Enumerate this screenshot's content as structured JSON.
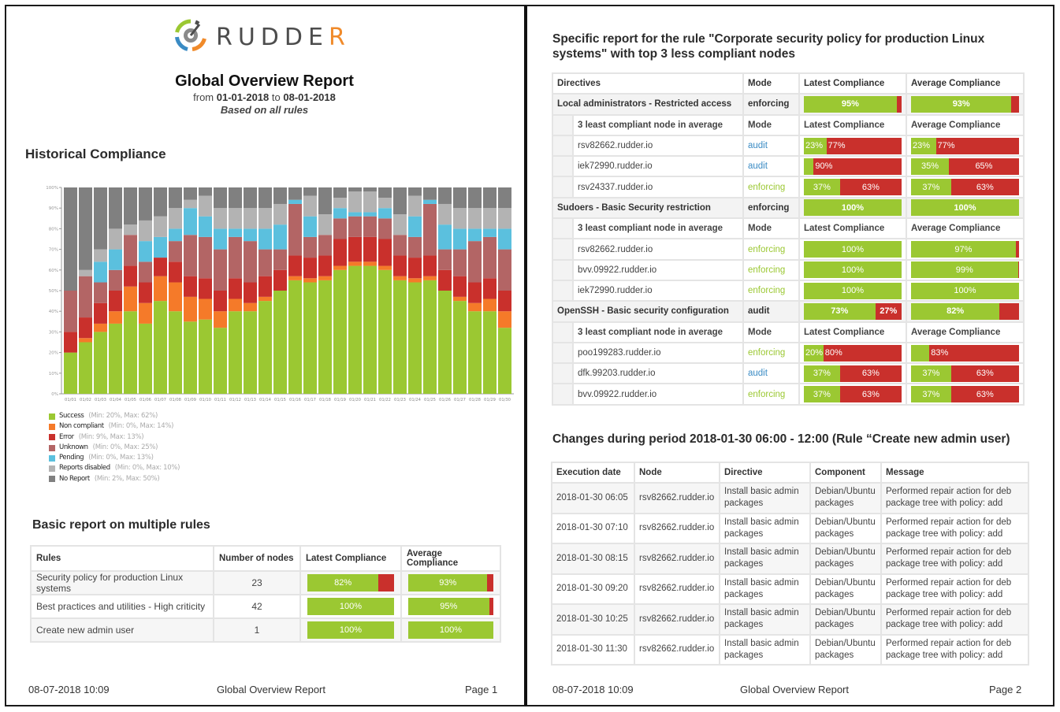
{
  "page1": {
    "logo": {
      "icon": "rudder-gear-logo-icon",
      "text_main": "RUDDE",
      "text_accent": "R"
    },
    "title": "Global Overview Report",
    "range_prefix": "from",
    "range_from": "01-01-2018",
    "range_to_word": "to",
    "range_to": "08-01-2018",
    "basis": "Based on all rules",
    "historical_title": "Historical Compliance",
    "basic_title": "Basic report on multiple rules",
    "basic_table": {
      "headers": [
        "Rules",
        "Number of nodes",
        "Latest Compliance",
        "Average Compliance"
      ],
      "rows": [
        {
          "rule": "Security policy for production Linux systems",
          "nodes": "23",
          "latest": 82,
          "latest_label": "82%",
          "average": 93,
          "average_label": "93%"
        },
        {
          "rule": "Best practices and utilities - High criticity",
          "nodes": "42",
          "latest": 100,
          "latest_label": "100%",
          "average": 95,
          "average_label": "95%"
        },
        {
          "rule": "Create new admin user",
          "nodes": "1",
          "latest": 100,
          "latest_label": "100%",
          "average": 100,
          "average_label": "100%"
        }
      ]
    },
    "footer": {
      "date": "08-07-2018 10:09",
      "title": "Global Overview Report",
      "page": "Page 1"
    }
  },
  "chart_data": {
    "type": "bar",
    "stacked": true,
    "title": "Historical Compliance",
    "xlabel": "",
    "ylabel": "",
    "ylim": [
      0,
      100
    ],
    "yticks": [
      "0%",
      "10%",
      "20%",
      "30%",
      "40%",
      "50%",
      "60%",
      "70%",
      "80%",
      "90%",
      "100%"
    ],
    "categories": [
      "01/01",
      "01/02",
      "01/03",
      "01/04",
      "01/05",
      "01/06",
      "01/07",
      "01/08",
      "01/09",
      "01/10",
      "01/11",
      "01/12",
      "01/13",
      "01/14",
      "01/15",
      "01/16",
      "01/17",
      "01/18",
      "01/19",
      "01/20",
      "01/21",
      "01/22",
      "01/23",
      "01/24",
      "01/25",
      "01/26",
      "01/27",
      "01/28",
      "01/29",
      "01/30"
    ],
    "legend_position": "bottom-left",
    "series": [
      {
        "name": "Success",
        "range": "(Min: 20%, Max: 62%)",
        "color": "#9bc832",
        "values": [
          20,
          25,
          30,
          34,
          40,
          34,
          45,
          40,
          35,
          36,
          32,
          40,
          40,
          45,
          50,
          55,
          54,
          55,
          60,
          62,
          62,
          60,
          55,
          54,
          55,
          50,
          45,
          40,
          40,
          32
        ]
      },
      {
        "name": "Non compliant",
        "range": "(Min: 0%, Max: 14%)",
        "color": "#f57a29",
        "values": [
          0,
          2,
          4,
          6,
          12,
          10,
          12,
          14,
          12,
          10,
          8,
          6,
          4,
          2,
          0,
          2,
          2,
          2,
          2,
          2,
          2,
          2,
          2,
          2,
          2,
          0,
          2,
          4,
          6,
          8
        ]
      },
      {
        "name": "Error",
        "range": "(Min: 9%, Max: 13%)",
        "color": "#c9302c",
        "values": [
          10,
          10,
          10,
          10,
          10,
          10,
          9,
          10,
          10,
          10,
          10,
          10,
          10,
          10,
          10,
          10,
          10,
          10,
          13,
          12,
          12,
          13,
          10,
          10,
          10,
          10,
          10,
          10,
          10,
          10
        ]
      },
      {
        "name": "Unknown",
        "range": "(Min: 0%, Max: 25%)",
        "color": "#b36565",
        "values": [
          20,
          20,
          10,
          10,
          15,
          10,
          0,
          10,
          20,
          20,
          20,
          20,
          20,
          13,
          10,
          25,
          10,
          10,
          10,
          10,
          10,
          10,
          10,
          10,
          25,
          10,
          13,
          20,
          20,
          20
        ]
      },
      {
        "name": "Pending",
        "range": "(Min: 0%, Max: 13%)",
        "color": "#5bc0de",
        "values": [
          0,
          0,
          10,
          10,
          0,
          10,
          10,
          6,
          13,
          10,
          10,
          4,
          6,
          10,
          12,
          2,
          10,
          0,
          5,
          2,
          2,
          5,
          0,
          10,
          2,
          12,
          10,
          6,
          4,
          10
        ]
      },
      {
        "name": "Reports disabled",
        "range": "(Min: 0%, Max: 10%)",
        "color": "#b3b3b3",
        "values": [
          0,
          3,
          6,
          10,
          5,
          10,
          10,
          10,
          4,
          10,
          10,
          10,
          10,
          10,
          10,
          0,
          10,
          10,
          5,
          10,
          10,
          5,
          10,
          10,
          0,
          10,
          10,
          10,
          10,
          10
        ]
      },
      {
        "name": "No Report",
        "range": "(Min: 2%, Max: 50%)",
        "color": "#808080",
        "values": [
          50,
          40,
          30,
          20,
          18,
          16,
          14,
          10,
          6,
          4,
          10,
          10,
          10,
          10,
          8,
          6,
          4,
          13,
          5,
          2,
          2,
          5,
          13,
          4,
          6,
          8,
          10,
          10,
          10,
          10
        ]
      }
    ]
  },
  "page2": {
    "specific_title": "Specific report for the rule \"Corporate security policy for production Linux systems\" with top 3 less compliant nodes",
    "spec_headers": [
      "Directives",
      "Mode",
      "Latest Compliance",
      "Average Compliance"
    ],
    "sub_headers": [
      "3 least compliant node in average",
      "Mode",
      "Latest Compliance",
      "Average Compliance"
    ],
    "directives": [
      {
        "name": "Local administrators - Restricted access",
        "mode": "enforcing",
        "latest": [
          95,
          5
        ],
        "latest_labels": [
          "95%",
          ""
        ],
        "average": [
          93,
          7
        ],
        "average_labels": [
          "93%",
          ""
        ],
        "nodes": [
          {
            "node": "rsv82662.rudder.io",
            "mode": "audit",
            "latest": [
              23,
              77
            ],
            "latest_labels": [
              "23%",
              "77%"
            ],
            "average": [
              23,
              77
            ],
            "average_labels": [
              "23%",
              "77%"
            ]
          },
          {
            "node": "iek72990.rudder.io",
            "mode": "audit",
            "latest": [
              10,
              90
            ],
            "latest_labels": [
              "",
              "90%"
            ],
            "average": [
              35,
              65
            ],
            "average_labels": [
              "35%",
              "65%"
            ]
          },
          {
            "node": "rsv24337.rudder.io",
            "mode": "enforcing",
            "latest": [
              37,
              63
            ],
            "latest_labels": [
              "37%",
              "63%"
            ],
            "average": [
              37,
              63
            ],
            "average_labels": [
              "37%",
              "63%"
            ]
          }
        ]
      },
      {
        "name": "Sudoers - Basic Security restriction",
        "mode": "enforcing",
        "latest": [
          100,
          0
        ],
        "latest_labels": [
          "100%",
          ""
        ],
        "average": [
          100,
          0
        ],
        "average_labels": [
          "100%",
          ""
        ],
        "nodes": [
          {
            "node": "rsv82662.rudder.io",
            "mode": "enforcing",
            "latest": [
              100,
              0
            ],
            "latest_labels": [
              "100%",
              ""
            ],
            "average": [
              97,
              3
            ],
            "average_labels": [
              "97%",
              ""
            ]
          },
          {
            "node": "bvv.09922.rudder.io",
            "mode": "enforcing",
            "latest": [
              100,
              0
            ],
            "latest_labels": [
              "100%",
              ""
            ],
            "average": [
              99,
              1
            ],
            "average_labels": [
              "99%",
              ""
            ]
          },
          {
            "node": "iek72990.rudder.io",
            "mode": "enforcing",
            "latest": [
              100,
              0
            ],
            "latest_labels": [
              "100%",
              ""
            ],
            "average": [
              100,
              0
            ],
            "average_labels": [
              "100%",
              ""
            ]
          }
        ]
      },
      {
        "name": "OpenSSH - Basic security configuration",
        "mode": "audit",
        "latest": [
          73,
          27
        ],
        "latest_labels": [
          "73%",
          "27%"
        ],
        "average": [
          82,
          18
        ],
        "average_labels": [
          "82%",
          ""
        ],
        "nodes": [
          {
            "node": "poo199283.rudder.io",
            "mode": "enforcing",
            "latest": [
              20,
              80
            ],
            "latest_labels": [
              "20%",
              "80%"
            ],
            "average": [
              17,
              83
            ],
            "average_labels": [
              "",
              "83%"
            ]
          },
          {
            "node": "dfk.99203.rudder.io",
            "mode": "audit",
            "latest": [
              37,
              63
            ],
            "latest_labels": [
              "37%",
              "63%"
            ],
            "average": [
              37,
              63
            ],
            "average_labels": [
              "37%",
              "63%"
            ]
          },
          {
            "node": "bvv.09922.rudder.io",
            "mode": "enforcing",
            "latest": [
              37,
              63
            ],
            "latest_labels": [
              "37%",
              "63%"
            ],
            "average": [
              37,
              63
            ],
            "average_labels": [
              "37%",
              "63%"
            ]
          }
        ]
      }
    ],
    "changes_title": "Changes during period 2018-01-30 06:00 - 12:00 (Rule “Create new admin user)",
    "changes_headers": [
      "Execution date",
      "Node",
      "Directive",
      "Component",
      "Message"
    ],
    "changes_rows": [
      {
        "date": "2018-01-30 06:05",
        "node": "rsv82662.rudder.io",
        "directive": "Install basic admin packages",
        "component": "Debian/Ubuntu packages",
        "message": "Performed repair action for deb package tree with policy: add"
      },
      {
        "date": "2018-01-30 07:10",
        "node": "rsv82662.rudder.io",
        "directive": "Install basic admin packages",
        "component": "Debian/Ubuntu packages",
        "message": "Performed repair action for deb package tree with policy: add"
      },
      {
        "date": "2018-01-30 08:15",
        "node": "rsv82662.rudder.io",
        "directive": "Install basic admin packages",
        "component": "Debian/Ubuntu packages",
        "message": "Performed repair action for deb package tree with policy: add"
      },
      {
        "date": "2018-01-30 09:20",
        "node": "rsv82662.rudder.io",
        "directive": "Install basic admin packages",
        "component": "Debian/Ubuntu packages",
        "message": "Performed repair action for deb package tree with policy: add"
      },
      {
        "date": "2018-01-30 10:25",
        "node": "rsv82662.rudder.io",
        "directive": "Install basic admin packages",
        "component": "Debian/Ubuntu packages",
        "message": "Performed repair action for deb package tree with policy: add"
      },
      {
        "date": "2018-01-30 11:30",
        "node": "rsv82662.rudder.io",
        "directive": "Install basic admin packages",
        "component": "Debian/Ubuntu packages",
        "message": "Performed repair action for deb package tree with policy: add"
      }
    ],
    "footer": {
      "date": "08-07-2018 10:09",
      "title": "Global Overview Report",
      "page": "Page 2"
    }
  }
}
